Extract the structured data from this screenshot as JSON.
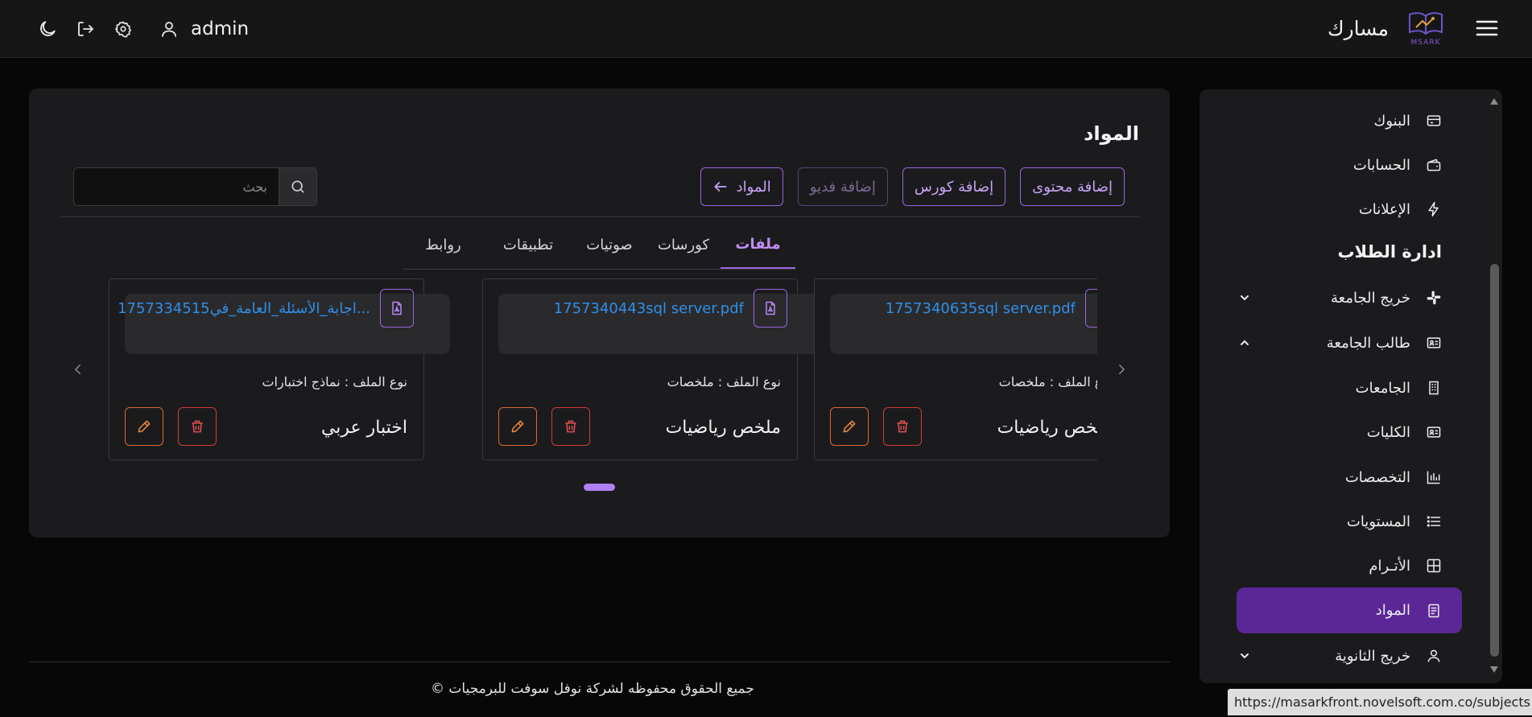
{
  "topbar": {
    "username": "admin",
    "brand_name": "مسارك",
    "logo_text": "MSARK",
    "icons": [
      "moon-icon",
      "logout-icon",
      "gear-icon",
      "user-icon",
      "menu-icon"
    ]
  },
  "sidebar": {
    "items_top": [
      {
        "label": "البنوك",
        "icon": "credit-card-icon"
      },
      {
        "label": "الحسابات",
        "icon": "wallet-icon"
      },
      {
        "label": "الإعلانات",
        "icon": "bolt-icon"
      }
    ],
    "section_heading": "ادارة الطلاب",
    "groups": [
      {
        "label": "خريج الجامعة",
        "icon": "slack-icon",
        "expanded": false
      },
      {
        "label": "طالب الجامعة",
        "icon": "id-card-icon",
        "expanded": true
      }
    ],
    "sub_items": [
      {
        "label": "الجامعات",
        "icon": "building-icon"
      },
      {
        "label": "الكليات",
        "icon": "id-card-icon"
      },
      {
        "label": "التخصصات",
        "icon": "bar-chart-icon"
      },
      {
        "label": "المستويات",
        "icon": "list-icon"
      },
      {
        "label": "الأتـرام",
        "icon": "grid-icon"
      },
      {
        "label": "المواد",
        "icon": "book-icon",
        "active": true
      }
    ],
    "last_group": {
      "label": "خريج الثانوية",
      "icon": "user-icon",
      "expanded": false
    }
  },
  "main": {
    "title": "المواد",
    "buttons": {
      "add_content": "إضافة محتوى",
      "add_course": "إضافة كورس",
      "add_video": "إضافة فديو",
      "subjects_back": "المواد"
    },
    "search": {
      "placeholder": "بحث",
      "value": ""
    },
    "tabs": [
      "ملفات",
      "كورسات",
      "صوتيات",
      "تطبيقات",
      "روابط"
    ],
    "active_tab": "ملفات",
    "cards": [
      {
        "file": "1757334515اجابة_الأسئلة_العامة_في...",
        "file_type": "نوع الملف : نماذج اختبارات",
        "title": "اختبار عربي"
      },
      {
        "file": "1757340443sql server.pdf",
        "file_type": "نوع الملف : ملخصات",
        "title": "ملخص رياضيات"
      },
      {
        "file": "1757340635sql server.pdf",
        "file_type": "نوع الملف : ملخصات",
        "title": "ملخص رياضيات"
      }
    ]
  },
  "footer": {
    "copyright": "جميع الحقوق محفوظه لشركة نوفل سوفت للبرمجيات ©"
  },
  "status_bar": {
    "url": "https://masarkfront.novelsoft.com.co/subjects"
  },
  "colors": {
    "accent": "#9a66e0",
    "active_item": "#5b2796",
    "link": "#2f8fe8",
    "edit": "#e0692b",
    "delete": "#d23a3a"
  }
}
